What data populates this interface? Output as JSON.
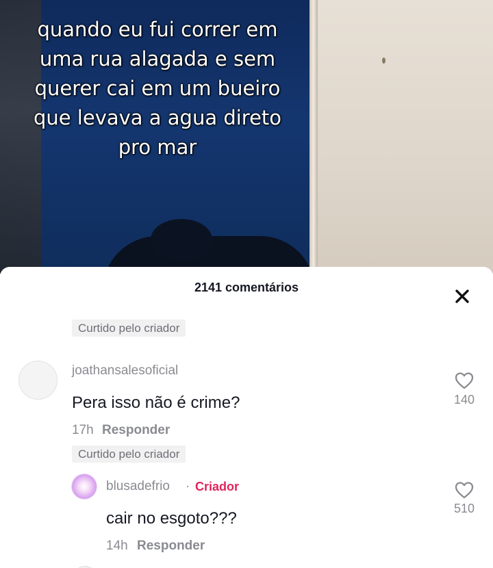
{
  "video": {
    "caption_lines": [
      "quando eu fui correr em",
      "uma rua alagada e sem",
      "querer cai em um bueiro",
      "que levava a agua direto",
      "pro mar"
    ]
  },
  "comments_sheet": {
    "title": "2141 comentários",
    "close_icon": "close-icon",
    "comments": [
      {
        "badge": "Curtido pelo criador",
        "username": "joathansalesoficial",
        "text": "Pera isso não é crime?",
        "time": "17h",
        "reply_label": "Responder",
        "likes": "140",
        "like_icon": "heart-outline-icon"
      },
      {
        "badge": "Curtido pelo criador",
        "username": "blusadefrio",
        "separator": "·",
        "creator_label": "Criador",
        "text": "cair no esgoto???",
        "time": "14h",
        "reply_label": "Responder",
        "likes": "510",
        "like_icon": "heart-outline-icon"
      }
    ]
  },
  "colors": {
    "creator_accent": "#e0245e",
    "secondary_text": "#8a8b91",
    "primary_text": "#161823",
    "badge_bg": "#f1f1f2"
  }
}
